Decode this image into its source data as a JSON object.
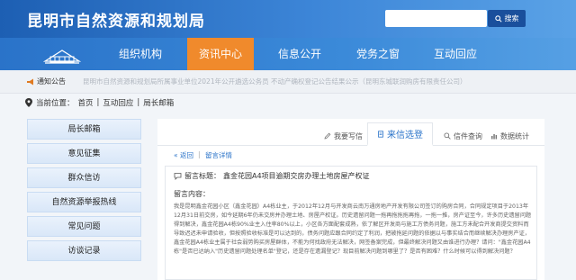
{
  "header": {
    "site_title": "昆明市自然资源和规划局",
    "search_placeholder": "",
    "search_label": "搜索"
  },
  "nav": {
    "items": [
      {
        "label": "组织机构"
      },
      {
        "label": "资讯中心"
      },
      {
        "label": "信息公开"
      },
      {
        "label": "党务之窗"
      },
      {
        "label": "互动回应"
      }
    ],
    "active_index": 1
  },
  "notice": {
    "label": "通知公告",
    "text": "昆明市自然资源和规划局所属事业单位2021年公开遴选公务员    不动产确权登记公告结果公示（昆明东城联润购房有限责任公司）"
  },
  "breadcrumb": {
    "prefix": "当前位置：",
    "items": [
      "首页",
      "互动回应",
      "局长邮箱"
    ],
    "separator": "|"
  },
  "sidebar": {
    "items": [
      {
        "label": "局长邮箱"
      },
      {
        "label": "意见征集"
      },
      {
        "label": "群众信访"
      },
      {
        "label": "自然资源举报热线"
      },
      {
        "label": "常见问题"
      },
      {
        "label": "访谈记录"
      }
    ]
  },
  "panel": {
    "tabs": [
      {
        "label": "我要写信"
      },
      {
        "label": "来信选登"
      },
      {
        "label": "信件查询"
      },
      {
        "label": "数据统计"
      }
    ],
    "active_tab": 1,
    "back_label": "返回",
    "detail_label": "留言详情",
    "separator": "|",
    "title_label": "留言标题：",
    "title_value": "鑫金花园A4项目逾期交房办理土地房屋产权证",
    "content_label": "留言内容：",
    "content_text": "我是昆明鑫金花园小区（鑫金花园）A4栋业主，于2012年12月与开发商云南万通房地产开发有限公司签订的购房合同，合同规定项目于2013年12月31日前交房，如今延期6年仍未交房并办理土地、房屋产权证。历史遗留问题一拖再拖拖拖再拖，一拖一推，房产证至今，许多历史遗留问题得到解决，鑫金花园A4栋90%业主入住率80%以上，小区各方面配套成熟，依了解区开发商与施工方债务问题，施工方未配合开发商提交资料而导致迟迟未申请验收，但按照验收标准是可以达到的，债务问题应跟合同约定了利润，把被拖延问题的依据以与事实结合而继续解决办理房产证，鑫金花园A4栋业主属于社会弱势购买房屋群体，不能为何找政府无法解决，网签备案完成，但最终解决问题又由谁进行办理？请问：\"鑫金花园A4栋\"是否已达纳入\"历史遗留问题处理名单\"登记，还是存在遗漏登记？现目前解决问题到哪里了？是否有困难？什么时候可以得到解决问题？"
  },
  "colors": {
    "header_blue": "#1d5fb3",
    "nav_active": "#f08a2c",
    "link_blue": "#2a73c9"
  }
}
